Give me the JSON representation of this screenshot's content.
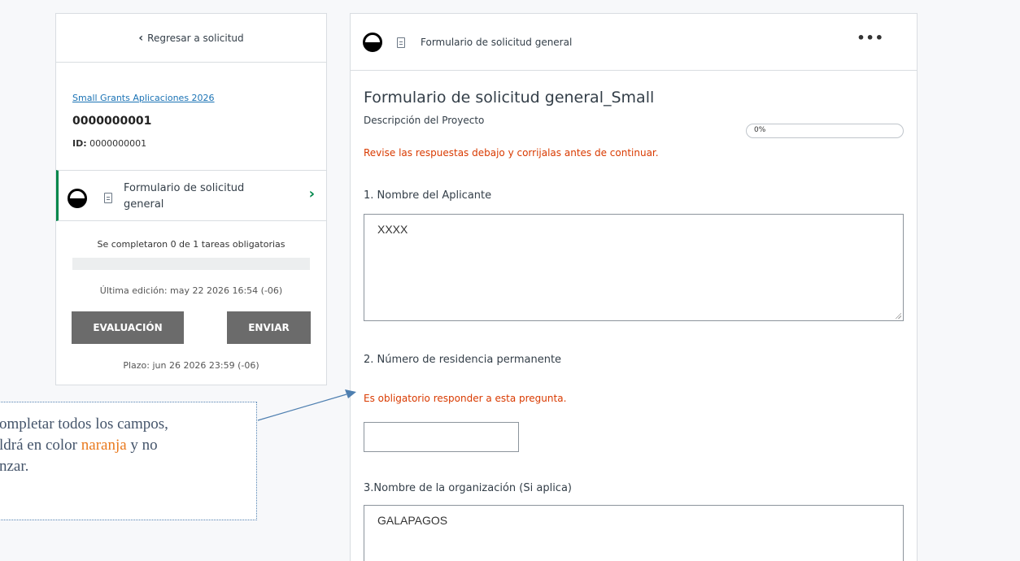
{
  "sidebar": {
    "back_label": "Regresar a solicitud",
    "program_link": "Small Grants Aplicaciones 2026",
    "application_number": "0000000001",
    "id_label": "ID:",
    "id_value": "0000000001",
    "task_label": "Formulario de solicitud general",
    "completed_text": "Se completaron 0 de 1 tareas obligatorias",
    "completed_progress": 0,
    "last_edited": "Última edición: may 22 2026 16:54 (-06)",
    "evaluation_button": "EVALUACIÓN",
    "send_button": "ENVIAR",
    "deadline": "Plazo: jun 26 2026 23:59 (-06)"
  },
  "main": {
    "header_title": "Formulario de solicitud general",
    "more_label": "•••",
    "form_title": "Formulario de solicitud general_Small",
    "page_label": "Descripción del Proyecto",
    "progress_text": "0%",
    "progress_value": 0,
    "error_message": "Revise las respuestas debajo y corrijalas antes de continuar.",
    "questions": [
      {
        "label": "1. Nombre del Aplicante",
        "value": "XXXX"
      },
      {
        "label": "2. Número de residencia permanente",
        "error": "Es obligatorio responder a esta pregunta.",
        "value": ""
      },
      {
        "label": "3.Nombre de la organización (Si aplica)",
        "value": "GALAPAGOS"
      }
    ]
  },
  "annotation": {
    "line1": "ompletar todos los campos,",
    "line2_a": "ldrá en color ",
    "line2_orange": "naranja",
    "line2_b": " y no",
    "line3": "nzar."
  },
  "colors": {
    "accent_green": "#00874b",
    "error_orange": "#d93a00",
    "annotation_orange": "#e97a1f",
    "link_blue": "#1b73b5"
  }
}
